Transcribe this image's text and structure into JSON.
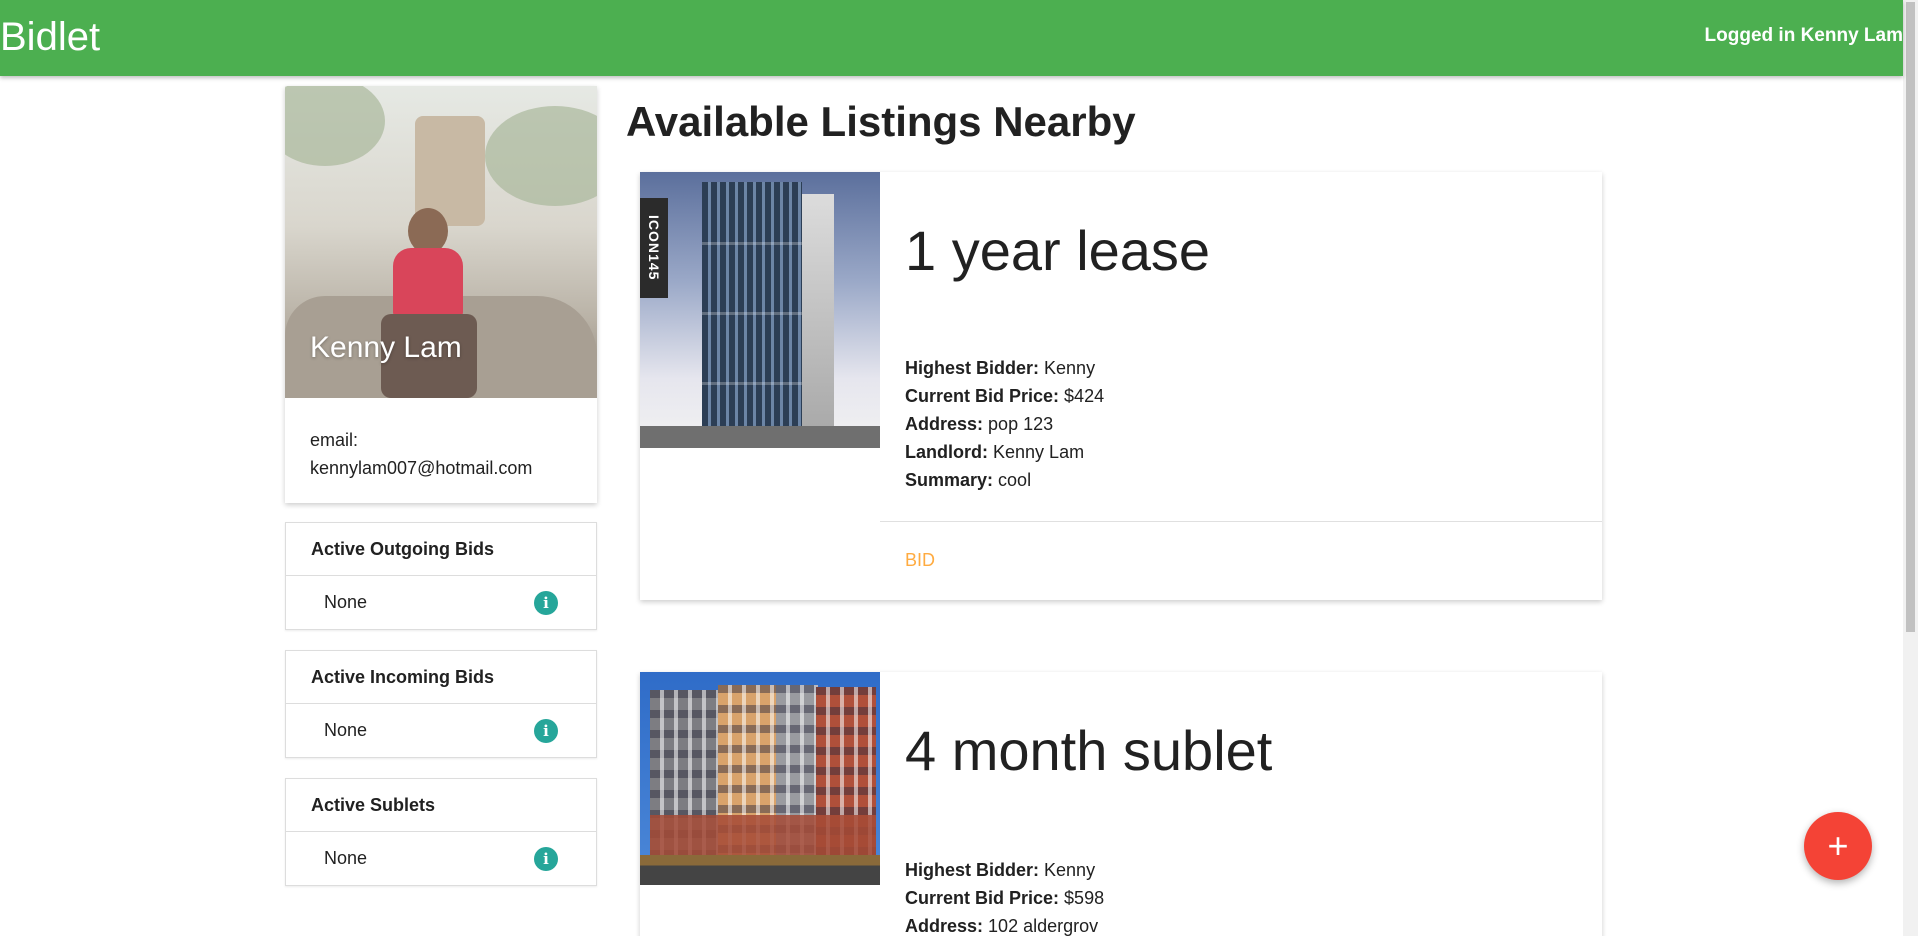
{
  "navbar": {
    "brand": "Bidlet",
    "logged_in_text": "Logged in Kenny Lam"
  },
  "profile": {
    "name": "Kenny Lam",
    "email_label": "email:",
    "email": "kennylam007@hotmail.com"
  },
  "sections": [
    {
      "title": "Active Outgoing Bids",
      "value": "None",
      "icon": "info-icon"
    },
    {
      "title": "Active Incoming Bids",
      "value": "None",
      "icon": "info-icon"
    },
    {
      "title": "Active Sublets",
      "value": "None",
      "icon": "info-icon"
    }
  ],
  "main": {
    "title": "Available Listings Nearby"
  },
  "listings": [
    {
      "title": "1 year lease",
      "image_sign": "ICON145",
      "highest_bidder_label": "Highest Bidder:",
      "highest_bidder": "Kenny",
      "current_bid_label": "Current Bid Price:",
      "current_bid": "$424",
      "address_label": "Address:",
      "address": "pop 123",
      "landlord_label": "Landlord:",
      "landlord": "Kenny Lam",
      "summary_label": "Summary:",
      "summary": "cool",
      "action": "BID"
    },
    {
      "title": "4 month sublet",
      "highest_bidder_label": "Highest Bidder:",
      "highest_bidder": "Kenny",
      "current_bid_label": "Current Bid Price:",
      "current_bid": "$598",
      "address_label": "Address:",
      "address": "102 aldergrov"
    }
  ],
  "fab": {
    "label": "+",
    "icon": "plus-icon"
  },
  "colors": {
    "navbar": "#4caf50",
    "info_icon": "#26a69a",
    "bid_link": "#ffab40",
    "fab": "#f44336"
  }
}
